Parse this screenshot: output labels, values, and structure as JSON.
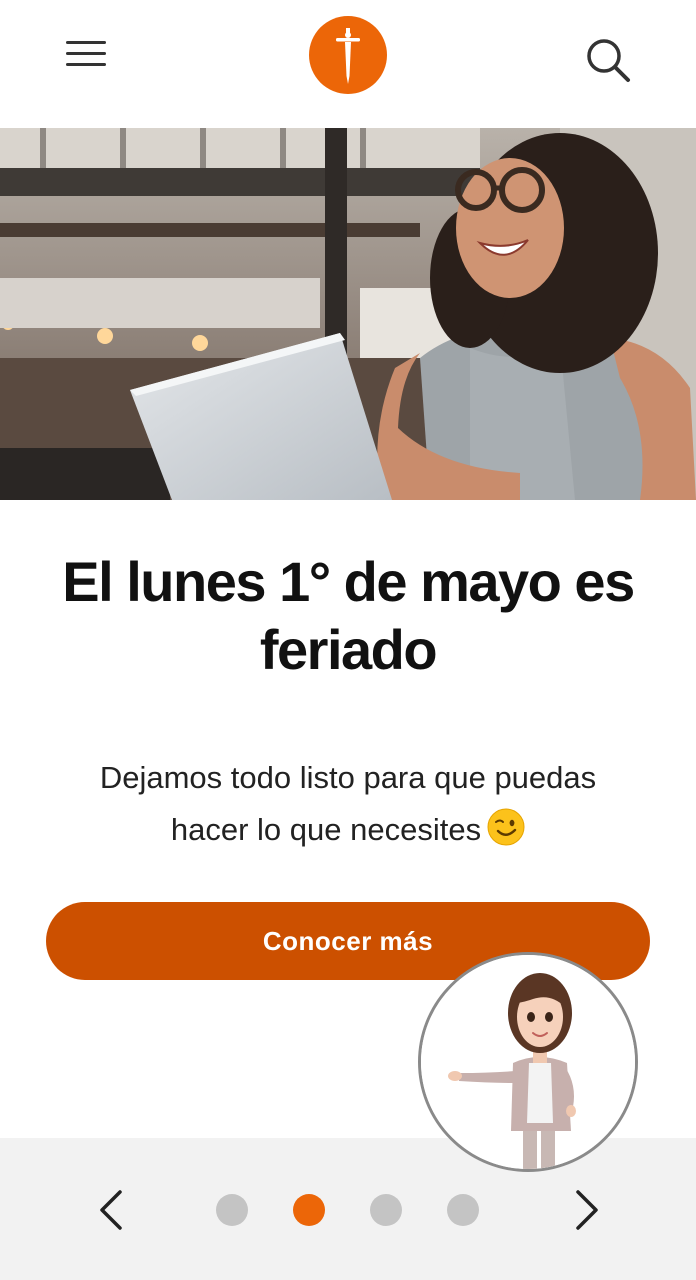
{
  "header": {
    "menu_icon": "hamburger-menu-icon",
    "logo_icon": "sword-cross-logo",
    "search_icon": "search-icon",
    "brand_color": "#ec6608"
  },
  "hero": {
    "image": "woman-laughing-at-laptop-photo"
  },
  "content": {
    "title": "El lunes 1° de mayo es feriado",
    "subtitle": "Dejamos todo listo para que puedas hacer lo que necesites",
    "subtitle_emoji": "winking-face-emoji",
    "cta_label": "Conocer más",
    "cta_color": "#cc5000"
  },
  "carousel": {
    "prev_icon": "chevron-left-icon",
    "next_icon": "chevron-right-icon",
    "total": 4,
    "active_index": 2,
    "active_color": "#ec6608",
    "inactive_color": "#c4c4c4"
  },
  "assistant": {
    "avatar": "virtual-assistant-avatar"
  }
}
